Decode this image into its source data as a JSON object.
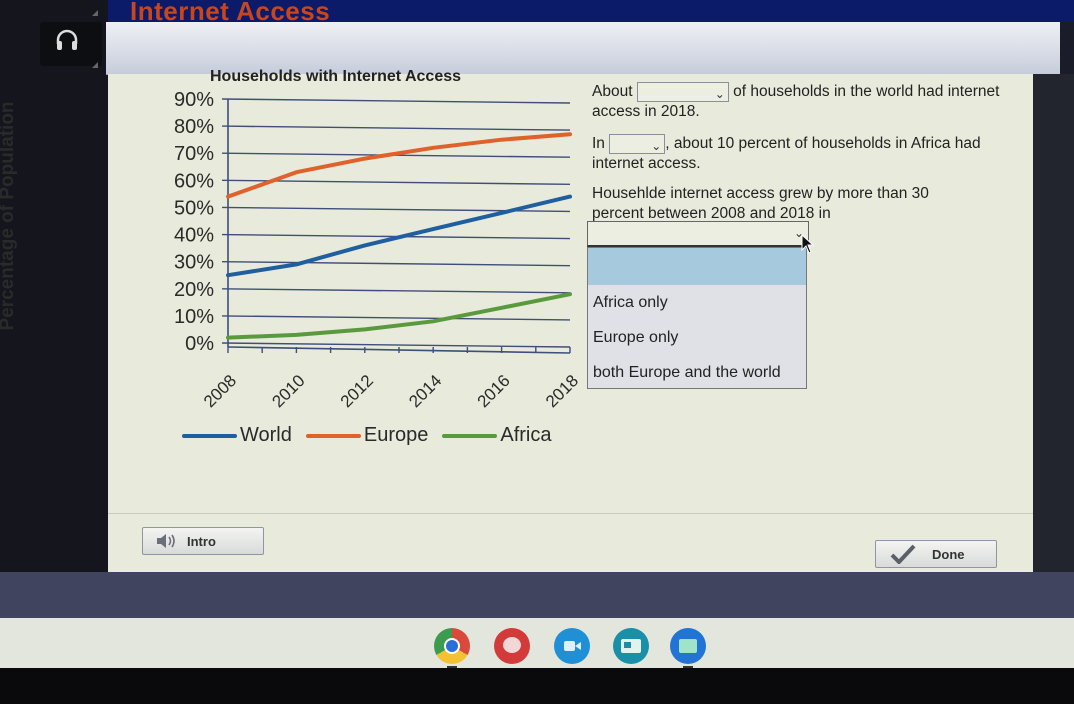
{
  "app": {
    "title": "Internet Access"
  },
  "sidebar": {
    "audio_icon": "headphones-icon"
  },
  "chart_data": {
    "type": "line",
    "title": "Households with Internet Access",
    "xlabel": "",
    "ylabel": "Percentage of Population",
    "x": [
      2008,
      2010,
      2012,
      2014,
      2016,
      2018
    ],
    "x_tick_labels": [
      "2008",
      "2010",
      "2012",
      "2014",
      "2016",
      "2018"
    ],
    "y_tick_labels": [
      "90%",
      "80%",
      "70%",
      "60%",
      "50%",
      "40%",
      "30%",
      "20%",
      "10%",
      "0%"
    ],
    "ylim": [
      0,
      90
    ],
    "grid": true,
    "legend_position": "bottom",
    "series": [
      {
        "name": "World",
        "color": "#1f5fa0",
        "values": [
          25,
          29,
          36,
          42,
          48,
          54
        ]
      },
      {
        "name": "Europe",
        "color": "#e0612a",
        "values": [
          54,
          63,
          68,
          72,
          75,
          77
        ]
      },
      {
        "name": "Africa",
        "color": "#5a9a3e",
        "values": [
          2,
          3,
          5,
          8,
          13,
          18
        ]
      }
    ]
  },
  "questions": {
    "q1": {
      "before": "About",
      "after": "of households in the world had internet access in 2018.",
      "selected": ""
    },
    "q2": {
      "before": "In",
      "after": ", about 10 percent of households in Africa had internet access.",
      "selected": ""
    },
    "q3": {
      "text": "Househlde internet access grew by more than 30 percent between 2008 and 2018 in",
      "selected": "",
      "options": [
        "",
        "Africa only",
        "Europe only",
        "both Europe and the world"
      ]
    }
  },
  "buttons": {
    "intro": "Intro",
    "done": "Done"
  },
  "dock": {
    "apps": [
      "chrome",
      "canvas-paint",
      "screencast",
      "classroom-slides",
      "files"
    ]
  }
}
